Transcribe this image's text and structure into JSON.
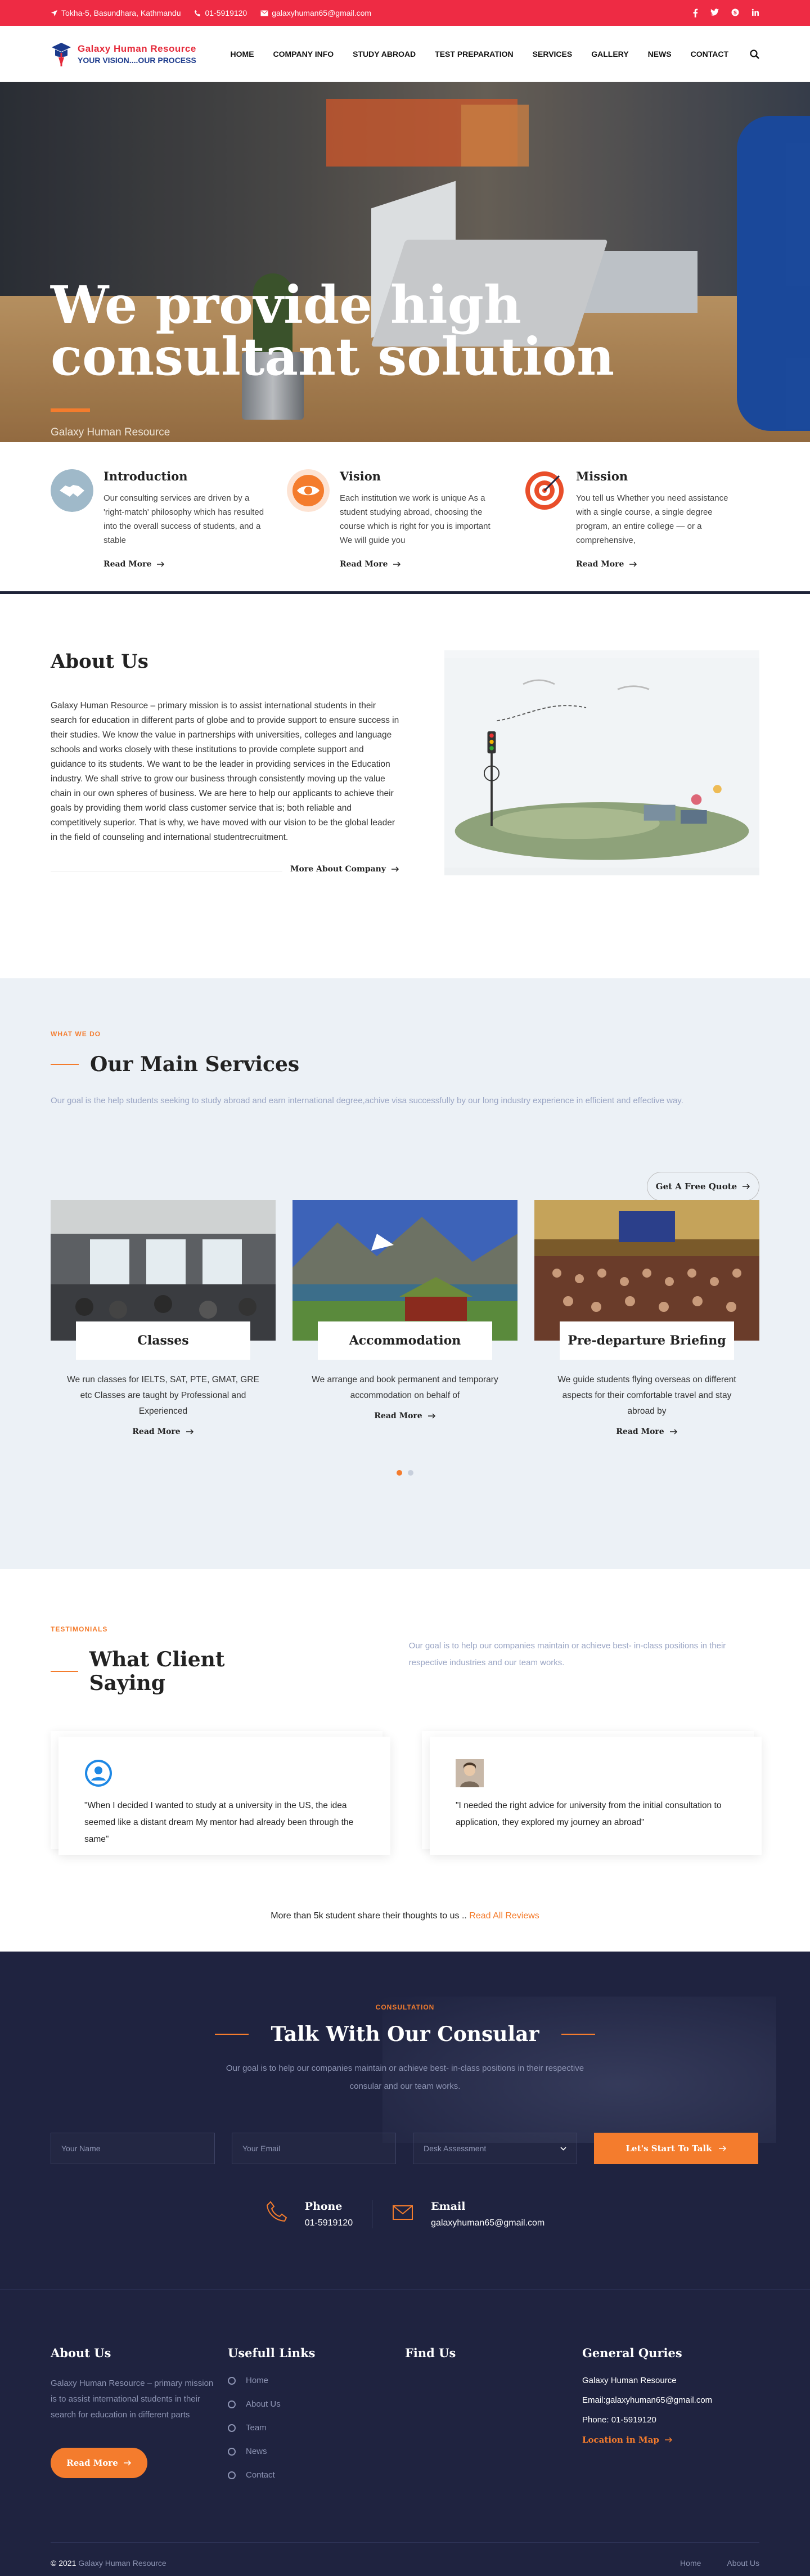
{
  "topbar": {
    "address": "Tokha-5, Basundhara, Kathmandu",
    "phone": "01-5919120",
    "email": "galaxyhuman65@gmail.com",
    "social": [
      "facebook-icon",
      "twitter-icon",
      "skype-icon",
      "linkedin-icon"
    ]
  },
  "brand": {
    "title": "Galaxy Human Resource",
    "tagline": "YOUR VISION....OUR PROCESS",
    "red": "#e52a3a",
    "blue": "#1b3a8c"
  },
  "nav": [
    "HOME",
    "COMPANY INFO",
    "STUDY ABROAD",
    "TEST PREPARATION",
    "SERVICES",
    "GALLERY",
    "NEWS",
    "CONTACT"
  ],
  "hero": {
    "title": "We provide high consultant solution",
    "subtitle": "Galaxy Human Resource"
  },
  "features": [
    {
      "title": "Introduction",
      "text": "Our consulting services are driven by a 'right-match' philosophy which has resulted into the overall success of students, and a stable",
      "link": "Read More"
    },
    {
      "title": "Vision",
      "text": "Each institution we work is unique As a student studying abroad, choosing the course which is right for you is important We will guide you",
      "link": "Read More"
    },
    {
      "title": "Mission",
      "text": "You tell us Whether you need assistance with a single course, a single degree program, an entire college — or a comprehensive,",
      "link": "Read More"
    }
  ],
  "about": {
    "title": "About Us",
    "text": "Galaxy Human Resource – primary mission is to assist international students in their search for education in different parts of globe and to provide support to ensure success in their studies. We know the value in partnerships with universities, colleges and language schools and works closely with these institutions to provide complete support and guidance to its students. We want to be the leader in providing services in the Education industry. We shall strive to grow our business through consistently moving up the value chain in our own spheres of business. We are here to help our applicants to achieve their goals by providing them world class customer service that is; both reliable and competitively superior. That is why, we have moved with our vision to be the global leader in the field of counseling and international studentrecruitment.",
    "more": "More About Company"
  },
  "services": {
    "kicker": "WHAT WE DO",
    "title": "Our Main Services",
    "desc": "Our goal is the help students seeking to study abroad and earn international degree,achive visa successfully by our long industry experience in efficient and effective way.",
    "quote": "Get A Free Quote",
    "cards": [
      {
        "title": "Classes",
        "text": "We run classes for IELTS, SAT, PTE, GMAT, GRE etc Classes are taught by Professional and Experienced",
        "link": "Read More"
      },
      {
        "title": "Accommodation",
        "text": "We arrange and book permanent and temporary accommodation on behalf of",
        "link": "Read More"
      },
      {
        "title": "Pre-departure Briefing",
        "text": "We guide students flying overseas on different aspects for their comfortable travel and stay abroad by",
        "link": "Read More"
      }
    ]
  },
  "testimonials": {
    "kicker": "TESTIMONIALS",
    "title": "What Client Saying",
    "desc": "Our goal is to help our companies maintain or achieve best- in-class positions in their respective industries and our team works.",
    "items": [
      {
        "text": "\"When I decided I wanted to study at a university in the US, the idea seemed like a distant dream My mentor had already been through the same\""
      },
      {
        "text": "\"I needed the right advice for university from the initial consultation to application, they explored my journey an abroad\""
      }
    ],
    "share": "More than 5k student share their thoughts to us .. ",
    "share_link": "Read All Reviews"
  },
  "consult": {
    "kicker": "CONSULTATION",
    "title": "Talk With Our Consular",
    "desc": "Our goal is to help our companies maintain or achieve best- in-class positions in their respective consular and our team works.",
    "name_ph": "Your Name",
    "email_ph": "Your Email",
    "select": "Desk Assessment",
    "cta": "Let's Start To Talk",
    "phone_label": "Phone",
    "phone": "01-5919120",
    "email_label": "Email",
    "email": "galaxyhuman65@gmail.com"
  },
  "footer": {
    "about_title": "About Us",
    "about_text": "Galaxy Human Resource – primary mission is to assist international students in their search for education in different parts",
    "read_more": "Read More",
    "links_title": "Usefull Links",
    "links": [
      "Home",
      "About Us",
      "Team",
      "News",
      "Contact"
    ],
    "find_title": "Find Us",
    "gq_title": "General Quries",
    "gq_name": "Galaxy Human Resource",
    "gq_email": "Email:galaxyhuman65@gmail.com",
    "gq_phone": "Phone: 01-5919120",
    "map": "Location in Map",
    "copyright_pre": "© 2021 ",
    "copyright": "Galaxy Human Resource",
    "bottom_links": [
      "Home",
      "About Us"
    ]
  },
  "colors": {
    "accent": "#f47c2d",
    "topbar": "#ee2b44",
    "dark": "#1f2340"
  }
}
